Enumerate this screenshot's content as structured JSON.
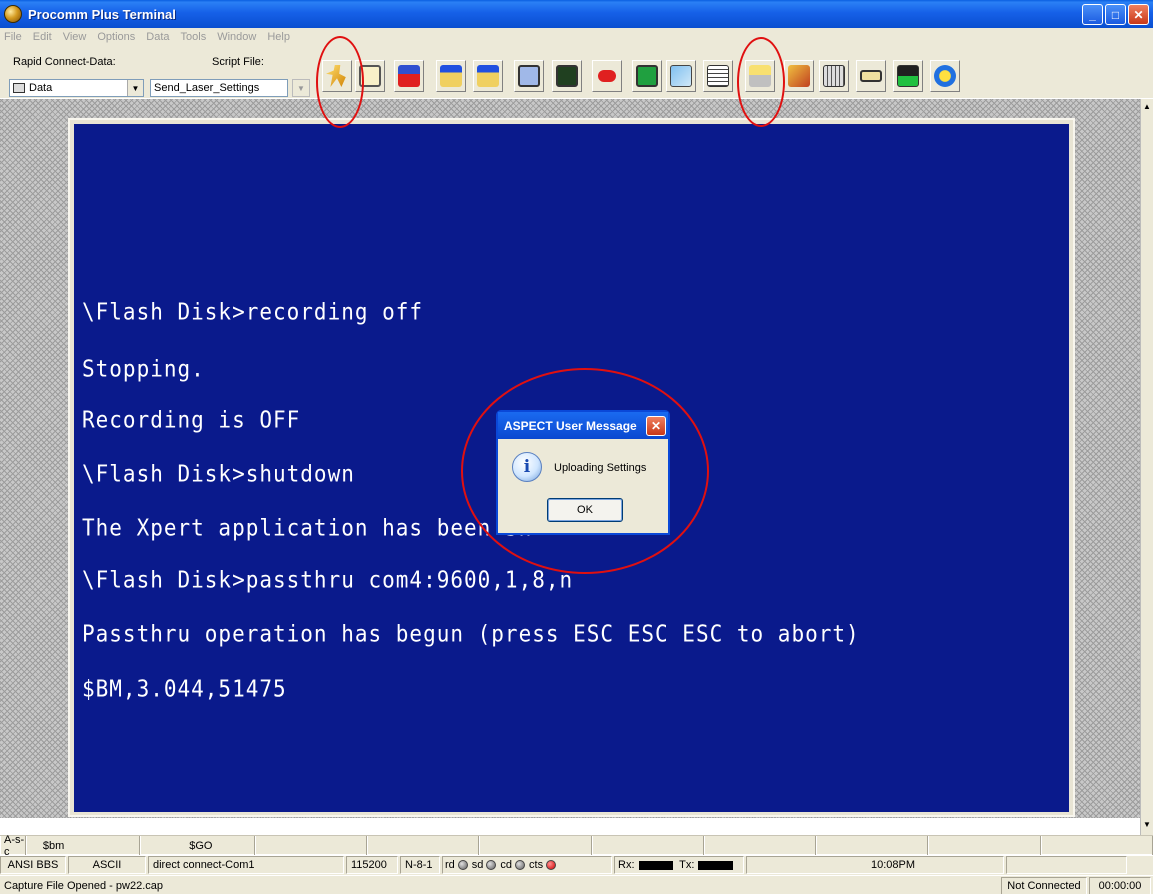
{
  "window": {
    "title": "Procomm Plus Terminal"
  },
  "menu": [
    "File",
    "Edit",
    "View",
    "Options",
    "Data",
    "Tools",
    "Window",
    "Help"
  ],
  "toolbar": {
    "rapid_connect_label": "Rapid Connect-Data:",
    "rapid_connect_value": "Data",
    "script_label": "Script File:",
    "script_value": "Send_Laser_Settings",
    "tools": [
      "run-script",
      "phonebook",
      "mode-toggle",
      "send-file",
      "receive-file",
      "upload",
      "terminal-display",
      "hangup",
      "monitor",
      "attach",
      "print",
      "capture-basket",
      "edit-script",
      "keyboard",
      "connect-cable",
      "meter-config",
      "help"
    ]
  },
  "terminal": {
    "lines": [
      "\\Flash Disk>recording off",
      "Stopping.",
      "Recording is OFF",
      "\\Flash Disk>shutdown",
      "The Xpert application has been sh",
      "\\Flash Disk>passthru com4:9600,1,8,n",
      "Passthru operation has begun (press ESC ESC ESC to abort)",
      "$BM,3.044,51475"
    ]
  },
  "dialog": {
    "title": "ASPECT User Message",
    "message": "Uploading Settings",
    "ok_label": "OK"
  },
  "macros": [
    "A-s-c",
    "$bm",
    "$GO"
  ],
  "status": {
    "emulation": "ANSI BBS",
    "transfer": "ASCII",
    "connection": "direct connect-Com1",
    "baud": "115200",
    "params": "N-8-1",
    "leds": [
      "rd",
      "sd",
      "cd",
      "cts"
    ],
    "rx_label": "Rx:",
    "tx_label": "Tx:",
    "time": "10:08PM"
  },
  "capture": {
    "message": "Capture File Opened - pw22.cap",
    "connection_state": "Not Connected",
    "elapsed": "00:00:00"
  },
  "colors": {
    "terminal_bg": "#0a1a8c",
    "annotation": "#e01010",
    "titlebar": "#0a4fd0"
  }
}
